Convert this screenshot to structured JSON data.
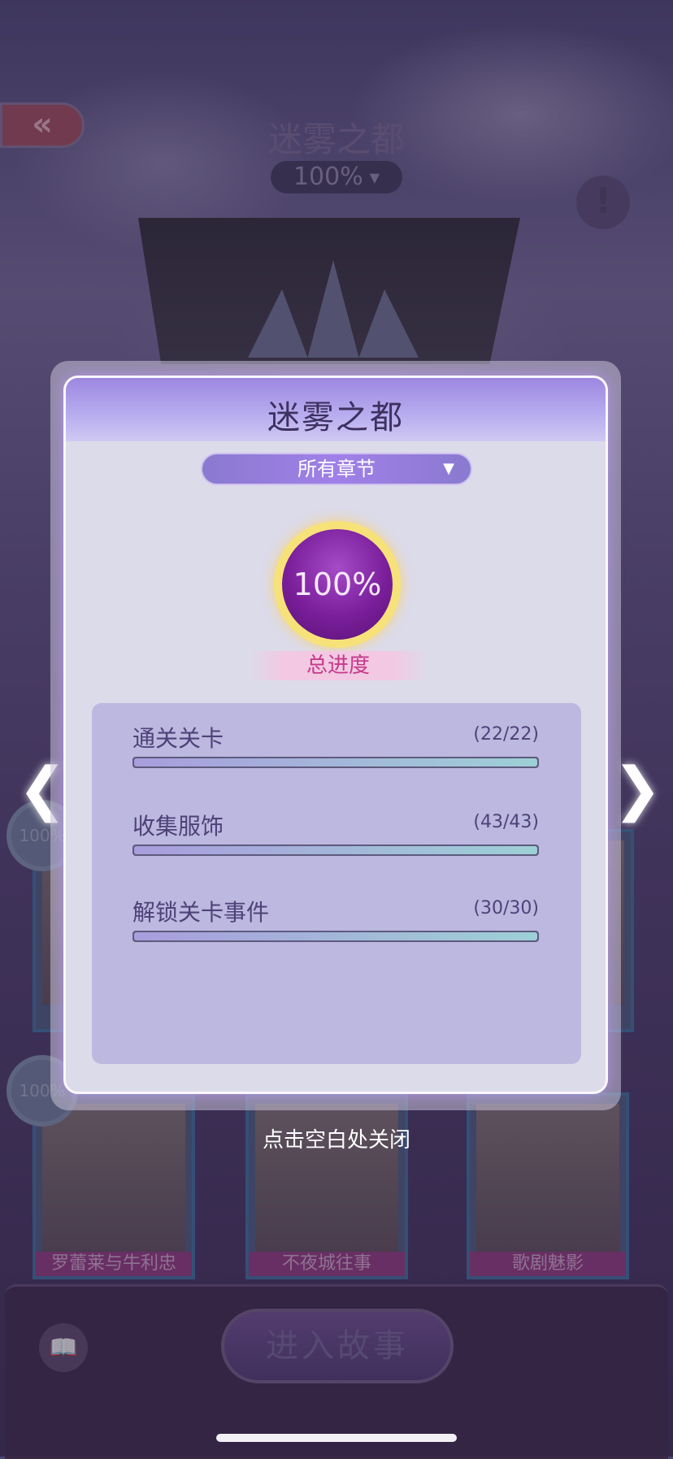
{
  "scene": {
    "title": "迷雾之都",
    "progress": "100%",
    "back_icon": "double-chevron-left-icon",
    "info_icon": "exclamation-icon"
  },
  "cards": {
    "row1_medal": "100%",
    "row2_medal": "100%",
    "row2_medal_b": "100%",
    "labels": [
      "罗蕾莱与牛利忠",
      "不夜城往事",
      "歌剧魅影"
    ]
  },
  "modal": {
    "title": "迷雾之都",
    "chapter_select": "所有章节",
    "overall_percent": "100%",
    "overall_label": "总进度",
    "stats": [
      {
        "name": "通关关卡",
        "count": "(22/22)",
        "progress": 1.0
      },
      {
        "name": "收集服饰",
        "count": "(43/43)",
        "progress": 1.0
      },
      {
        "name": "解锁关卡事件",
        "count": "(30/30)",
        "progress": 1.0
      }
    ]
  },
  "tap_to_close": "点击空白处关闭",
  "bottom": {
    "enter_story": "进入故事",
    "book_icon": "book-gear-icon"
  },
  "colors": {
    "accent": "#9d87e0",
    "badge_gold": "#f7e27a",
    "badge_purple": "#7a1e9a",
    "label_pink": "#c53a8c"
  }
}
